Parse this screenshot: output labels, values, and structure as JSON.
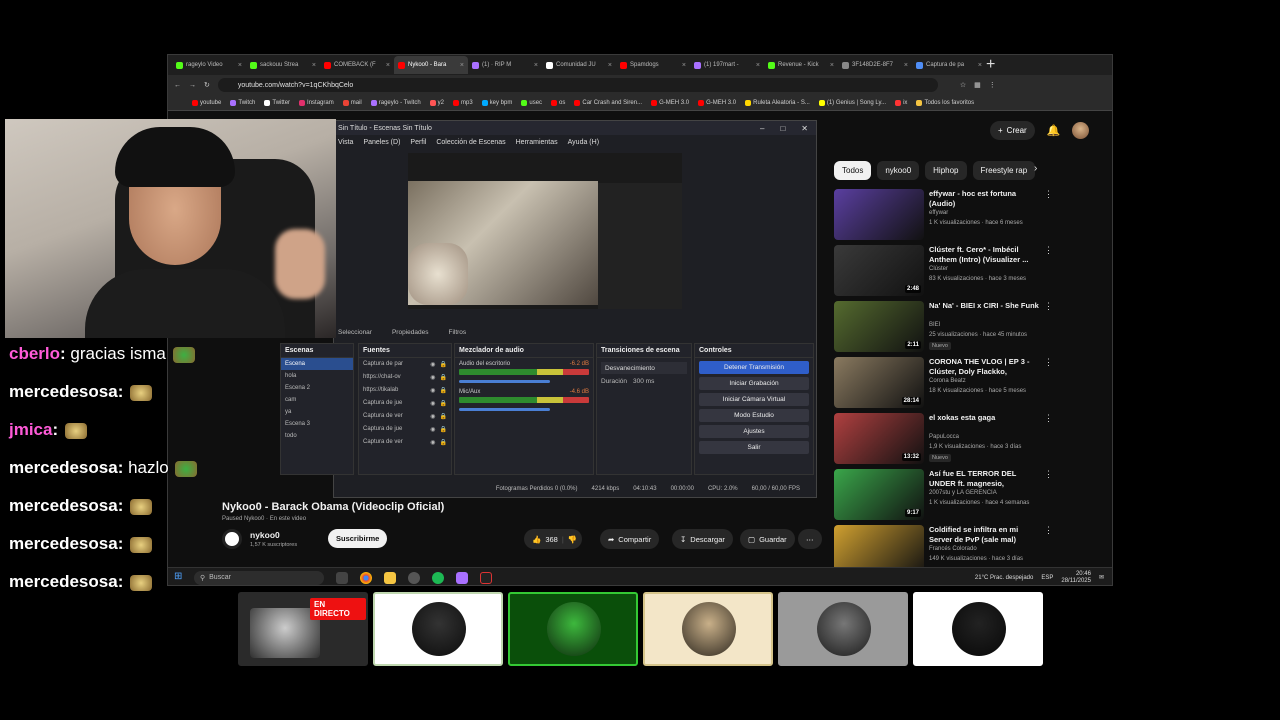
{
  "browser": {
    "tabs": [
      {
        "label": "rageylo Video",
        "color": "#53fc18"
      },
      {
        "label": "sackouu Strea",
        "color": "#53fc18"
      },
      {
        "label": "COMEBACK (F",
        "color": "#ff0000"
      },
      {
        "label": "Nykoo0 - Bara",
        "color": "#ff0000",
        "active": true
      },
      {
        "label": "(1) · RIP M",
        "color": "#a970ff"
      },
      {
        "label": "Comunidad JU",
        "color": "#ffffff"
      },
      {
        "label": "Spamdogs",
        "color": "#ff0000"
      },
      {
        "label": "(1) 197mart -",
        "color": "#a970ff"
      },
      {
        "label": "Revenue - Kick",
        "color": "#53fc18"
      },
      {
        "label": "3F148D2E-8F7",
        "color": "#888888"
      },
      {
        "label": "Captura de pa",
        "color": "#4f8df5"
      }
    ],
    "url": "youtube.com/watch?v=1qCKhbqCelo",
    "bookmarks": [
      {
        "label": "youtube",
        "color": "#ff0000"
      },
      {
        "label": "Twitch",
        "color": "#a970ff"
      },
      {
        "label": "Twitter",
        "color": "#ffffff"
      },
      {
        "label": "Instagram",
        "color": "#e1306c"
      },
      {
        "label": "mail",
        "color": "#ea4335"
      },
      {
        "label": "rageylo - Twitch",
        "color": "#a970ff"
      },
      {
        "label": "y2",
        "color": "#ff5555"
      },
      {
        "label": "mp3",
        "color": "#ff0000"
      },
      {
        "label": "key bpm",
        "color": "#00aaff"
      },
      {
        "label": "usec",
        "color": "#53fc18"
      },
      {
        "label": "os",
        "color": "#ff0000"
      },
      {
        "label": "Car Crash and Siren...",
        "color": "#ff0000"
      },
      {
        "label": "G-MEH 3.0",
        "color": "#ff0000"
      },
      {
        "label": "G-MEH 3.0",
        "color": "#ff0000"
      },
      {
        "label": "Ruleta Aleatoria - S...",
        "color": "#ffd700"
      },
      {
        "label": "(1) Genius | Song Ly...",
        "color": "#ffff00"
      },
      {
        "label": "ix",
        "color": "#ff3333"
      },
      {
        "label": "Todos los favoritos",
        "color": "#f5c542"
      }
    ]
  },
  "youtube": {
    "create_label": "Crear",
    "chips": [
      "Todos",
      "nykoo0",
      "Hiphop",
      "Freestyle rap"
    ],
    "video_title": "Nykoo0 - Barack Obama (Videoclip Oficial)",
    "paused_text": "Paused Nykoo0 · En este video",
    "channel_name": "nykoo0",
    "channel_subs": "1,57 K suscriptores",
    "subscribe_label": "Suscribirme",
    "likes": "368",
    "share_label": "Compartir",
    "download_label": "Descargar",
    "save_label": "Guardar",
    "recommendations": [
      {
        "title": "effywar - hoc est fortuna (Audio)",
        "channel": "effywar",
        "meta": "1 K visualizaciones · hace 6 meses",
        "duration": "",
        "thumb": "#5a3fa0"
      },
      {
        "title": "Clúster ft. Cero* - Imbécil Anthem (Intro) (Visualizer ...",
        "channel": "Clúster",
        "meta": "83 K visualizaciones · hace 3 meses",
        "duration": "2:48",
        "thumb": "#3a3a3a"
      },
      {
        "title": "Na' Na' - BIEI x CIRI - She Funk",
        "channel": "BIEI",
        "meta": "25 visualizaciones · hace 45 minutos",
        "duration": "2:11",
        "badge": "Nuevo",
        "thumb": "#556b2f"
      },
      {
        "title": "CORONA THE VLOG | EP 3 - Clúster, Doly Flackko, Frozoud...",
        "channel": "Corona Beatz",
        "meta": "18 K visualizaciones · hace 5 meses",
        "duration": "28:14",
        "thumb": "#8a7a60"
      },
      {
        "title": "el xokas esta gaga",
        "channel": "PapuLocca",
        "meta": "1,9 K visualizaciones · hace 3 días",
        "duration": "13:32",
        "badge": "Nuevo",
        "thumb": "#b04040"
      },
      {
        "title": "Así fue EL TERROR DEL UNDER ft. magnesio, jovenalien, white...",
        "channel": "2007stu y LA GERENCIA",
        "meta": "1 K visualizaciones · hace 4 semanas",
        "duration": "9:17",
        "thumb": "#3aa64a"
      },
      {
        "title": "Coldified se infiltra en mi Server de PvP (sale mal)",
        "channel": "Francés Colorado",
        "meta": "149 K visualizaciones · hace 3 días",
        "duration": "",
        "thumb": "#d0a030"
      }
    ]
  },
  "obs": {
    "title": "Sin Título - Escenas Sin Título",
    "menu": [
      "Vista",
      "Paneles (D)",
      "Perfil",
      "Colección de Escenas",
      "Herramientas",
      "Ayuda (H)"
    ],
    "tabs": [
      "Propiedades",
      "Filtros"
    ],
    "selection_label": "Seleccionar",
    "scenes_header": "Escenas",
    "scenes": [
      "Escena",
      "hola",
      "Escena 2",
      "cam",
      "ya",
      "Escena 3",
      "todo"
    ],
    "sources_header": "Fuentes",
    "sources": [
      "Captura de par",
      "https://chat-ov",
      "https://tikalab",
      "Captura de jue",
      "Captura de ver",
      "Captura de jue",
      "Captura de ver"
    ],
    "mixer_header": "Mezclador de audio",
    "mixer_tracks": [
      {
        "name": "Audio del escritorio",
        "db": "-6.2 dB"
      },
      {
        "name": "Mic/Aux",
        "db": "-4.6 dB"
      }
    ],
    "transitions_header": "Transiciones de escena",
    "transition_value": "Desvanecimiento",
    "duration_label": "Duración",
    "duration_value": "300 ms",
    "controls_header": "Controles",
    "controls": [
      "Detener Transmisión",
      "Iniciar Grabación",
      "Iniciar Cámara Virtual",
      "Modo Estudio",
      "Ajustes",
      "Salir"
    ],
    "status": [
      "Fotogramas Perdidos 0 (0.0%)",
      "4214 kbps",
      "04:10:43",
      "00:00:00",
      "CPU: 2.0%",
      "60,00 / 60,00 FPS"
    ]
  },
  "taskbar": {
    "search_placeholder": "Buscar",
    "weather": "21°C  Prac. despejado",
    "lang": "ESP",
    "time": "20:46",
    "date": "28/11/2025"
  },
  "chat": [
    {
      "user": "cberlo",
      "user_color": "#ff5bd8",
      "text": "gracias isma",
      "emote": "#3cb043"
    },
    {
      "user": "mercedesosa",
      "user_color": "#ffffff",
      "text": "",
      "emote": "#e8d080"
    },
    {
      "user": "jmica",
      "user_color": "#ff5bd8",
      "text": "",
      "emote": "#e8d080"
    },
    {
      "user": "mercedesosa",
      "user_color": "#ffffff",
      "text": "hazlo",
      "emote": "#3cb043"
    },
    {
      "user": "mercedesosa",
      "user_color": "#ffffff",
      "text": "",
      "emote": "#e8d080"
    },
    {
      "user": "mercedesosa",
      "user_color": "#ffffff",
      "text": "",
      "emote": "#e8d080"
    },
    {
      "user": "mercedesosa",
      "user_color": "#ffffff",
      "text": "",
      "emote": "#e8d080"
    }
  ],
  "live_badge": "EN DIRECTO",
  "tiles": [
    {
      "name": "live-screen",
      "bg": "#2a2a2a",
      "border": "#2a2a2a",
      "face": "#ccc"
    },
    {
      "name": "skull",
      "bg": "#ffffff",
      "border": "#c0d8b0",
      "face": "#333"
    },
    {
      "name": "green-cat",
      "bg": "#0a4f0a",
      "border": "#34c934",
      "face": "#3db83d"
    },
    {
      "name": "cat",
      "bg": "#f3e6c8",
      "border": "#d5c48a",
      "face": "#c9b089"
    },
    {
      "name": "gray-cat",
      "bg": "#9a9a9a",
      "border": "#999999",
      "face": "#777"
    },
    {
      "name": "bulldog",
      "bg": "#ffffff",
      "border": "#ffffff",
      "face": "#222"
    }
  ]
}
